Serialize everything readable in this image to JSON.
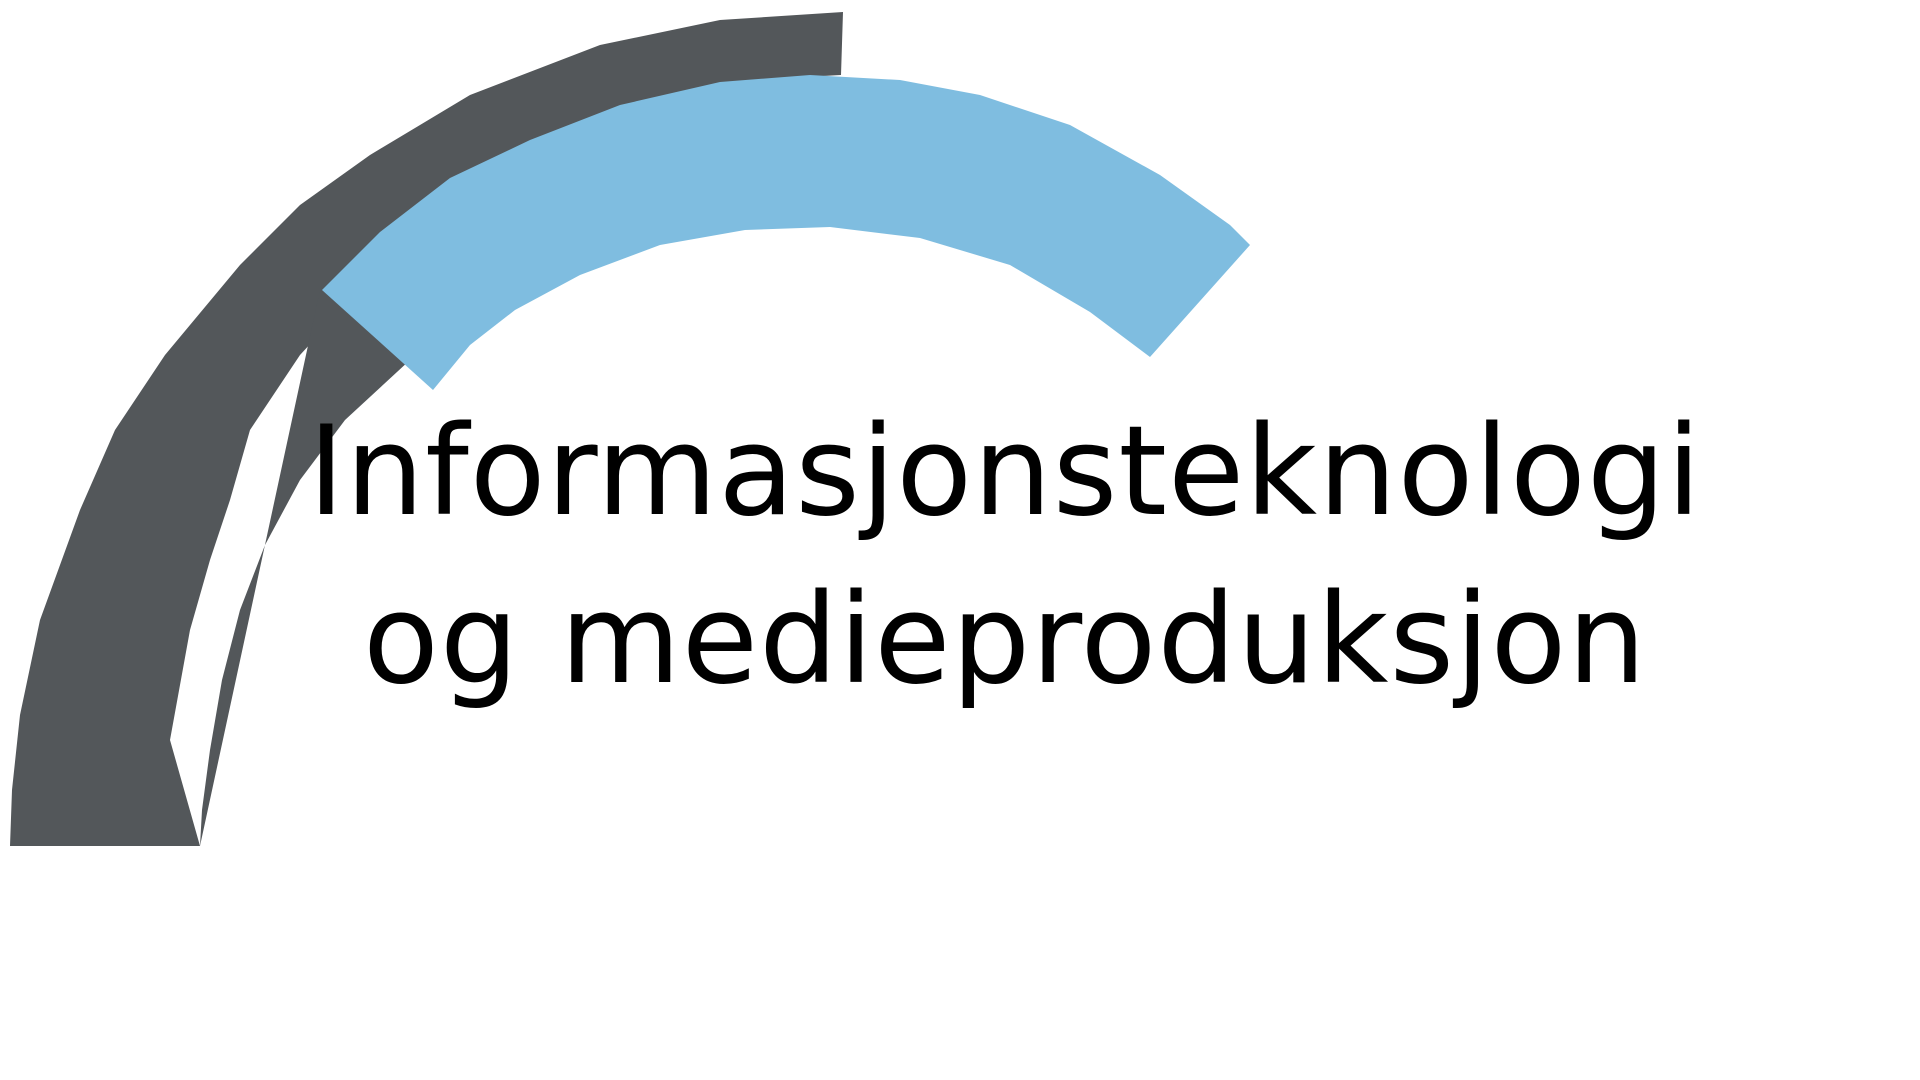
{
  "logo": {
    "line1": "Informasjonsteknologi",
    "line2": "og medieproduksjon"
  },
  "colors": {
    "dark_arc": "#53575a",
    "light_arc": "#7fbde0",
    "text": "#000000",
    "background": "#ffffff"
  }
}
